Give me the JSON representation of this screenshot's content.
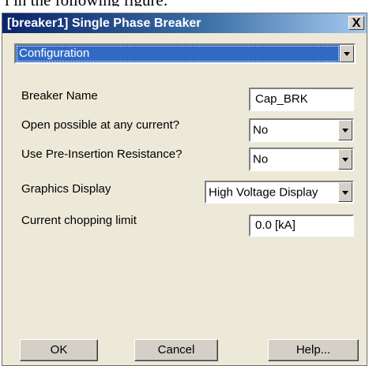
{
  "window": {
    "title": "[breaker1] Single Phase Breaker",
    "close_glyph": "X",
    "caption_above": "l in the following figure:"
  },
  "section_select": {
    "selected": "Configuration"
  },
  "fields": {
    "breaker_name": {
      "label": "Breaker Name",
      "value": "Cap_BRK"
    },
    "open_possible": {
      "label": "Open possible at any current?",
      "value": "No"
    },
    "pre_insertion": {
      "label": "Use Pre-Insertion Resistance?",
      "value": "No"
    },
    "graphics_display": {
      "label": "Graphics Display",
      "value": "High Voltage Display"
    },
    "current_chopping": {
      "label": "Current chopping limit",
      "value": "0.0 [kA]"
    }
  },
  "buttons": {
    "ok": "OK",
    "cancel": "Cancel",
    "help": "Help..."
  },
  "colors": {
    "titlebar_start": "#0a246a",
    "titlebar_end": "#a6caf0",
    "selection": "#316ac5",
    "dialog_bg": "#ece9d8"
  }
}
